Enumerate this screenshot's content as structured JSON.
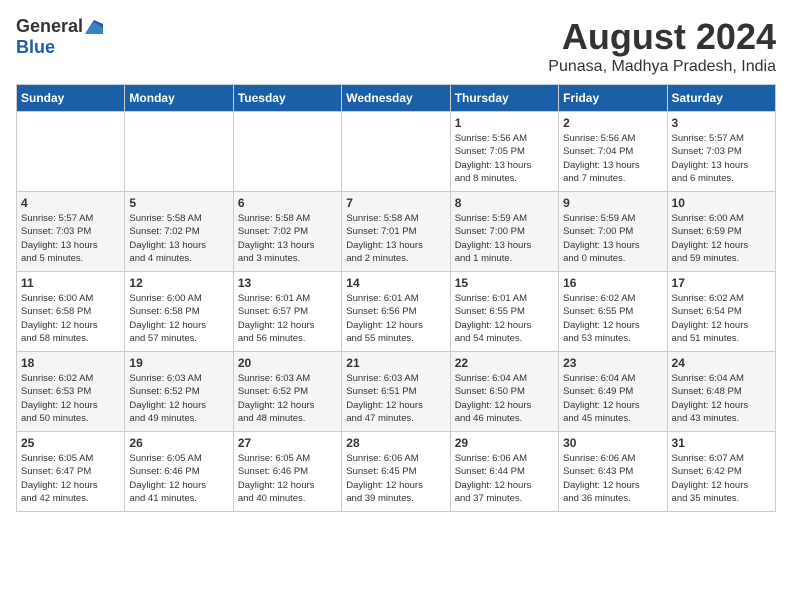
{
  "header": {
    "logo_general": "General",
    "logo_blue": "Blue",
    "month": "August 2024",
    "location": "Punasa, Madhya Pradesh, India"
  },
  "weekdays": [
    "Sunday",
    "Monday",
    "Tuesday",
    "Wednesday",
    "Thursday",
    "Friday",
    "Saturday"
  ],
  "weeks": [
    [
      {
        "day": "",
        "info": ""
      },
      {
        "day": "",
        "info": ""
      },
      {
        "day": "",
        "info": ""
      },
      {
        "day": "",
        "info": ""
      },
      {
        "day": "1",
        "info": "Sunrise: 5:56 AM\nSunset: 7:05 PM\nDaylight: 13 hours\nand 8 minutes."
      },
      {
        "day": "2",
        "info": "Sunrise: 5:56 AM\nSunset: 7:04 PM\nDaylight: 13 hours\nand 7 minutes."
      },
      {
        "day": "3",
        "info": "Sunrise: 5:57 AM\nSunset: 7:03 PM\nDaylight: 13 hours\nand 6 minutes."
      }
    ],
    [
      {
        "day": "4",
        "info": "Sunrise: 5:57 AM\nSunset: 7:03 PM\nDaylight: 13 hours\nand 5 minutes."
      },
      {
        "day": "5",
        "info": "Sunrise: 5:58 AM\nSunset: 7:02 PM\nDaylight: 13 hours\nand 4 minutes."
      },
      {
        "day": "6",
        "info": "Sunrise: 5:58 AM\nSunset: 7:02 PM\nDaylight: 13 hours\nand 3 minutes."
      },
      {
        "day": "7",
        "info": "Sunrise: 5:58 AM\nSunset: 7:01 PM\nDaylight: 13 hours\nand 2 minutes."
      },
      {
        "day": "8",
        "info": "Sunrise: 5:59 AM\nSunset: 7:00 PM\nDaylight: 13 hours\nand 1 minute."
      },
      {
        "day": "9",
        "info": "Sunrise: 5:59 AM\nSunset: 7:00 PM\nDaylight: 13 hours\nand 0 minutes."
      },
      {
        "day": "10",
        "info": "Sunrise: 6:00 AM\nSunset: 6:59 PM\nDaylight: 12 hours\nand 59 minutes."
      }
    ],
    [
      {
        "day": "11",
        "info": "Sunrise: 6:00 AM\nSunset: 6:58 PM\nDaylight: 12 hours\nand 58 minutes."
      },
      {
        "day": "12",
        "info": "Sunrise: 6:00 AM\nSunset: 6:58 PM\nDaylight: 12 hours\nand 57 minutes."
      },
      {
        "day": "13",
        "info": "Sunrise: 6:01 AM\nSunset: 6:57 PM\nDaylight: 12 hours\nand 56 minutes."
      },
      {
        "day": "14",
        "info": "Sunrise: 6:01 AM\nSunset: 6:56 PM\nDaylight: 12 hours\nand 55 minutes."
      },
      {
        "day": "15",
        "info": "Sunrise: 6:01 AM\nSunset: 6:55 PM\nDaylight: 12 hours\nand 54 minutes."
      },
      {
        "day": "16",
        "info": "Sunrise: 6:02 AM\nSunset: 6:55 PM\nDaylight: 12 hours\nand 53 minutes."
      },
      {
        "day": "17",
        "info": "Sunrise: 6:02 AM\nSunset: 6:54 PM\nDaylight: 12 hours\nand 51 minutes."
      }
    ],
    [
      {
        "day": "18",
        "info": "Sunrise: 6:02 AM\nSunset: 6:53 PM\nDaylight: 12 hours\nand 50 minutes."
      },
      {
        "day": "19",
        "info": "Sunrise: 6:03 AM\nSunset: 6:52 PM\nDaylight: 12 hours\nand 49 minutes."
      },
      {
        "day": "20",
        "info": "Sunrise: 6:03 AM\nSunset: 6:52 PM\nDaylight: 12 hours\nand 48 minutes."
      },
      {
        "day": "21",
        "info": "Sunrise: 6:03 AM\nSunset: 6:51 PM\nDaylight: 12 hours\nand 47 minutes."
      },
      {
        "day": "22",
        "info": "Sunrise: 6:04 AM\nSunset: 6:50 PM\nDaylight: 12 hours\nand 46 minutes."
      },
      {
        "day": "23",
        "info": "Sunrise: 6:04 AM\nSunset: 6:49 PM\nDaylight: 12 hours\nand 45 minutes."
      },
      {
        "day": "24",
        "info": "Sunrise: 6:04 AM\nSunset: 6:48 PM\nDaylight: 12 hours\nand 43 minutes."
      }
    ],
    [
      {
        "day": "25",
        "info": "Sunrise: 6:05 AM\nSunset: 6:47 PM\nDaylight: 12 hours\nand 42 minutes."
      },
      {
        "day": "26",
        "info": "Sunrise: 6:05 AM\nSunset: 6:46 PM\nDaylight: 12 hours\nand 41 minutes."
      },
      {
        "day": "27",
        "info": "Sunrise: 6:05 AM\nSunset: 6:46 PM\nDaylight: 12 hours\nand 40 minutes."
      },
      {
        "day": "28",
        "info": "Sunrise: 6:06 AM\nSunset: 6:45 PM\nDaylight: 12 hours\nand 39 minutes."
      },
      {
        "day": "29",
        "info": "Sunrise: 6:06 AM\nSunset: 6:44 PM\nDaylight: 12 hours\nand 37 minutes."
      },
      {
        "day": "30",
        "info": "Sunrise: 6:06 AM\nSunset: 6:43 PM\nDaylight: 12 hours\nand 36 minutes."
      },
      {
        "day": "31",
        "info": "Sunrise: 6:07 AM\nSunset: 6:42 PM\nDaylight: 12 hours\nand 35 minutes."
      }
    ]
  ]
}
